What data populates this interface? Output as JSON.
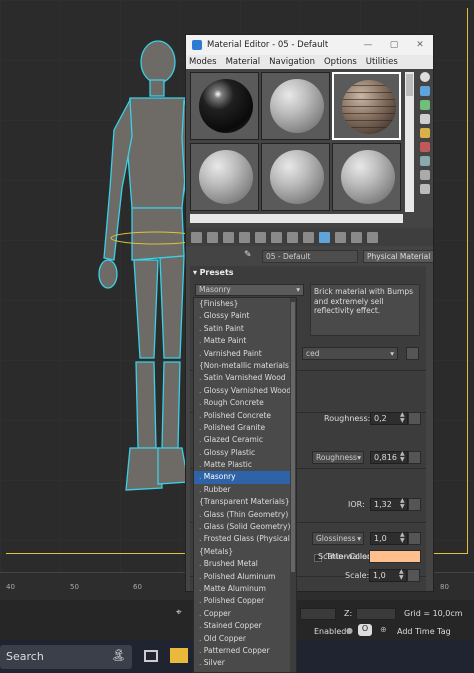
{
  "window": {
    "title": "Material Editor - 05 - Default",
    "minimize": "—",
    "maximize": "▢",
    "close": "✕"
  },
  "menu": [
    "Modes",
    "Material",
    "Navigation",
    "Options",
    "Utilities"
  ],
  "material": {
    "name": "05 - Default",
    "type": "Physical Material"
  },
  "presets": {
    "header": "Presets",
    "selected": "Masonry",
    "description": "Brick material with Bumps and extremely sell reflectivity effect."
  },
  "dropdown": {
    "items": [
      {
        "label": "{Finishes}",
        "sub": false
      },
      {
        "label": "Glossy Paint",
        "sub": true
      },
      {
        "label": "Satin Paint",
        "sub": true
      },
      {
        "label": "Matte Paint",
        "sub": true
      },
      {
        "label": "Varnished Paint",
        "sub": true
      },
      {
        "label": "{Non-metallic materials}",
        "sub": false
      },
      {
        "label": "Satin Varnished Wood",
        "sub": true
      },
      {
        "label": "Glossy Varnished Wood",
        "sub": true
      },
      {
        "label": "Rough Concrete",
        "sub": true
      },
      {
        "label": "Polished Concrete",
        "sub": true
      },
      {
        "label": "Polished Granite",
        "sub": true
      },
      {
        "label": "Glazed Ceramic",
        "sub": true
      },
      {
        "label": "Glossy Plastic",
        "sub": true
      },
      {
        "label": "Matte Plastic",
        "sub": true
      },
      {
        "label": "Masonry",
        "sub": true,
        "selected": true
      },
      {
        "label": "Rubber",
        "sub": true
      },
      {
        "label": "{Transparent Materials}",
        "sub": false
      },
      {
        "label": "Glass (Thin Geometry)",
        "sub": true
      },
      {
        "label": "Glass (Solid Geometry)",
        "sub": true
      },
      {
        "label": "Frosted Glass (Physical)",
        "sub": true
      },
      {
        "label": "{Metals}",
        "sub": false
      },
      {
        "label": "Brushed Metal",
        "sub": true
      },
      {
        "label": "Polished Aluminum",
        "sub": true
      },
      {
        "label": "Matte Aluminum",
        "sub": true
      },
      {
        "label": "Polished Copper",
        "sub": true
      },
      {
        "label": "Copper",
        "sub": true
      },
      {
        "label": "Stained Copper",
        "sub": true
      },
      {
        "label": "Old Copper",
        "sub": true
      },
      {
        "label": "Patterned Copper",
        "sub": true
      },
      {
        "label": "Silver",
        "sub": true
      }
    ]
  },
  "params": {
    "mode_value": "ced",
    "roughness_label": "Roughness:",
    "roughness_value": "0,2",
    "roughness_mode": "Roughness",
    "roughness2_value": "0,816",
    "ior_label": "IOR:",
    "ior_value": "1,32",
    "glossiness_mode": "Glossiness",
    "glossiness_value": "1,0",
    "thin_walled_label": "Thin-walled",
    "scatter_color_label": "Scatter Color:",
    "scatter_color": "#ffc08e",
    "scale_label": "Scale:",
    "scale_value": "1,0"
  },
  "ruler": {
    "ticks": [
      "40",
      "50",
      "60",
      "70",
      "80"
    ]
  },
  "status": {
    "z_label": "Z:",
    "grid": "Grid = 10,0cm",
    "enabled": "Enabled:",
    "add_time_tag": "Add Time Tag"
  },
  "taskbar": {
    "search": "Search"
  },
  "colors": {
    "viewport_bg": "#2b2b2b",
    "window_bg": "#444444",
    "highlight": "#2f63a8",
    "wireframe": "#3ad1e6",
    "grid_line": "#e0c33a"
  }
}
